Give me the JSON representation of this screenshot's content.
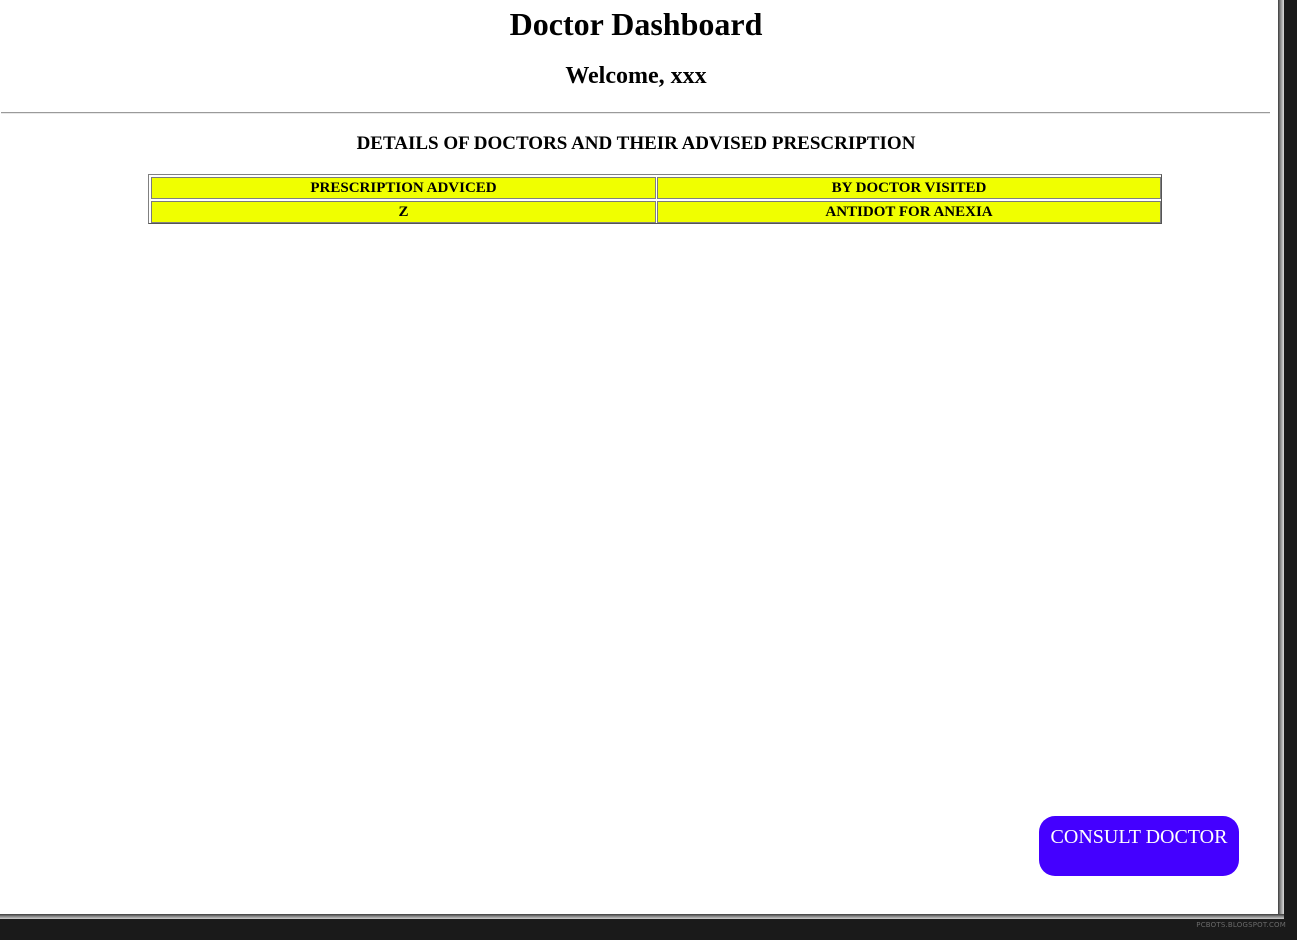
{
  "header": {
    "title": "Doctor Dashboard",
    "welcome": "Welcome, xxx"
  },
  "section": {
    "heading": "DETAILS OF DOCTORS AND THEIR ADVISED PRESCRIPTION"
  },
  "table": {
    "columns": [
      "PRESCRIPTION ADVICED",
      "BY DOCTOR VISITED"
    ],
    "rows": [
      [
        "Z",
        "ANTIDOT FOR ANEXIA"
      ]
    ]
  },
  "actions": {
    "consult_label": "CONSULT DOCTOR"
  },
  "watermark": "PCBOTS.BLOGSPOT.COM",
  "colors": {
    "cell_background": "#f0ff00",
    "button_background": "#4400ff",
    "button_text": "#ffffff"
  }
}
